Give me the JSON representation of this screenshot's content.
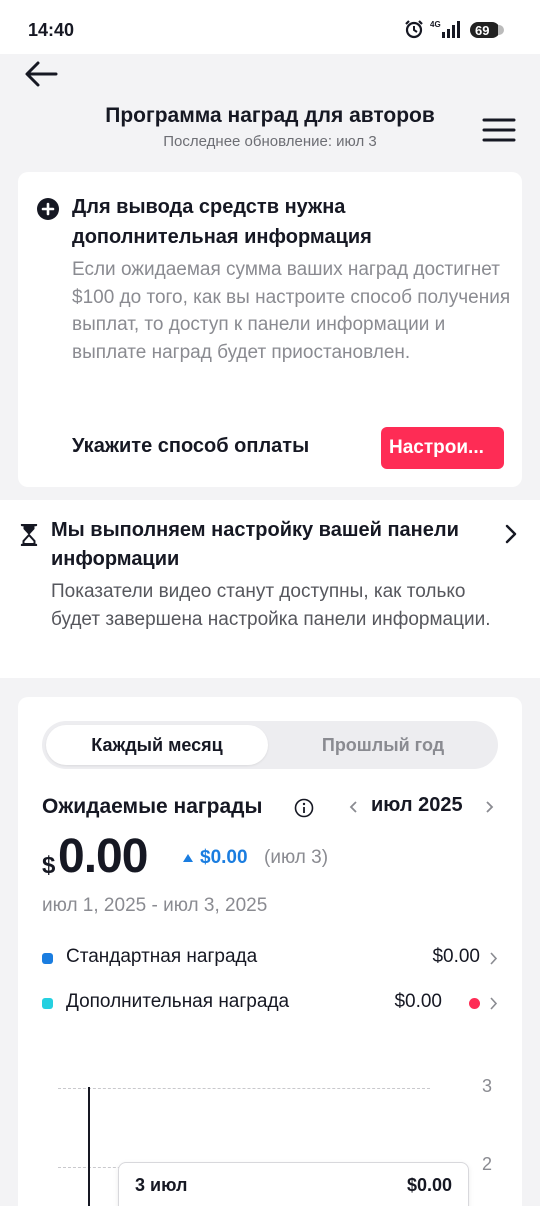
{
  "status_bar": {
    "time": "14:40",
    "battery": "69",
    "network": "4G"
  },
  "header": {
    "title": "Программа наград для авторов",
    "subtitle": "Последнее обновление: июл 3"
  },
  "alert": {
    "title": "Для вывода средств нужна дополнительная информация",
    "body": "Если ожидаемая сумма ваших наград достигнет $100 до того, как вы настроите способ получения выплат, то доступ к панели информации и выплате наград будет приостановлен.",
    "action_label": "Укажите способ оплаты",
    "button_label": "Настрои..."
  },
  "setup_banner": {
    "title": "Мы выполняем настройку вашей панели информации",
    "body": "Показатели видео станут доступны, как только будет завершена настройка панели информации."
  },
  "rewards": {
    "tabs": [
      "Каждый месяц",
      "Прошлый год"
    ],
    "label": "Ожидаемые награды",
    "month": "июл 2025",
    "currency": "$",
    "amount": "0.00",
    "delta": "$0.00",
    "delta_date": "(июл 3)",
    "range": "июл 1, 2025 - июл 3, 2025",
    "legend": [
      {
        "name": "Стандартная награда",
        "value": "$0.00",
        "color": "#1a7de0"
      },
      {
        "name": "Дополнительная награда",
        "value": "$0.00",
        "color": "#25d0e0"
      }
    ],
    "chart": {
      "ticks": [
        "3",
        "2"
      ]
    },
    "tooltip": {
      "date": "3 июл",
      "value": "$0.00"
    }
  },
  "colors": {
    "accent": "#fe2c55",
    "link": "#1a7de0"
  }
}
